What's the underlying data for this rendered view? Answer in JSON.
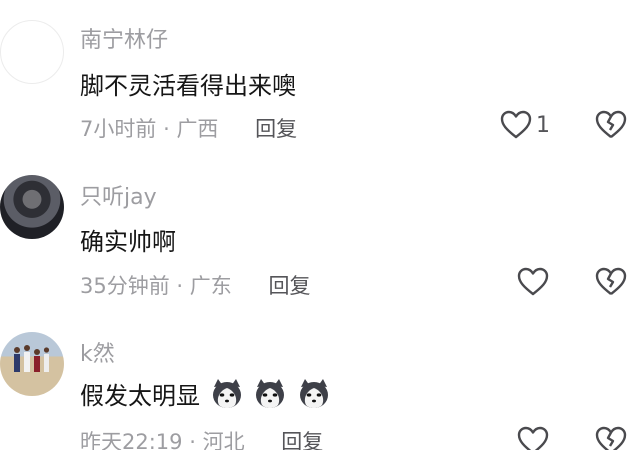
{
  "comments": [
    {
      "username": "南宁林仔",
      "text": "脚不灵活看得出来噢",
      "time": "7小时前",
      "location": "广西",
      "reply_label": "回复",
      "like_count": "1",
      "avatar_icon": "blank-avatar"
    },
    {
      "username": "只听jay",
      "text": "确实帅啊",
      "time": "35分钟前",
      "location": "广东",
      "reply_label": "回复",
      "like_count": "",
      "avatar_icon": "guitar-player-avatar"
    },
    {
      "username": "k然",
      "text": "假发太明显",
      "time": "昨天22:19",
      "location": "河北",
      "reply_label": "回复",
      "like_count": "",
      "avatar_icon": "basketball-court-avatar",
      "emoji": "husky-emoji"
    }
  ],
  "separator": "·"
}
